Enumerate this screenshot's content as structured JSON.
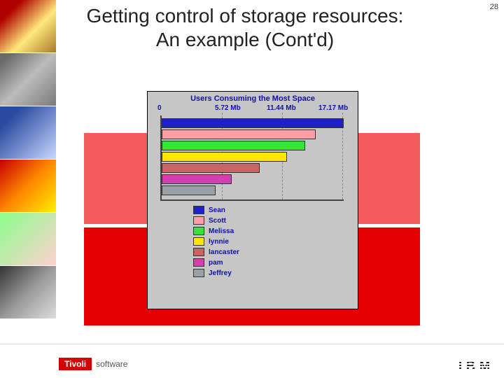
{
  "page_number": "28",
  "title_line1": "Getting control of storage resources:",
  "title_line2": "An example (Cont'd)",
  "branding": {
    "tivoli": "Tivoli",
    "software": "software",
    "ibm": "IBM"
  },
  "chart_data": {
    "type": "bar",
    "orientation": "horizontal",
    "title": "Users Consuming the Most Space",
    "xlabel": "",
    "ylabel": "",
    "xlim": [
      0,
      17.17
    ],
    "x_ticks": [
      0,
      5.72,
      11.44,
      17.17
    ],
    "x_tick_labels": [
      "0",
      "5.72 Mb",
      "11.44 Mb",
      "17.17 Mb"
    ],
    "categories": [
      "Sean",
      "Scott",
      "Melissa",
      "lynnie",
      "lancaster",
      "pam",
      "Jeffrey"
    ],
    "values": [
      17.17,
      14.5,
      13.5,
      11.8,
      9.2,
      6.5,
      5.0
    ],
    "colors": [
      "#2020c8",
      "#ff9ea6",
      "#36e636",
      "#ffe600",
      "#c86464",
      "#d63fb0",
      "#9aa0a6"
    ]
  }
}
